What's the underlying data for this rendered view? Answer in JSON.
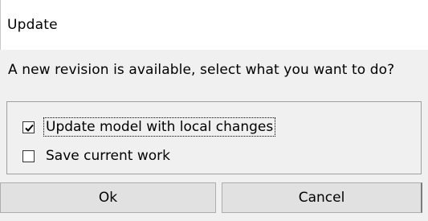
{
  "window": {
    "title": "Update"
  },
  "message": "A new revision is available, select what you want to do?",
  "options": [
    {
      "label": "Update model with local changes",
      "checked": true
    },
    {
      "label": "Save current work",
      "checked": false
    }
  ],
  "buttons": {
    "ok_label": "Ok",
    "cancel_label": "Cancel"
  }
}
